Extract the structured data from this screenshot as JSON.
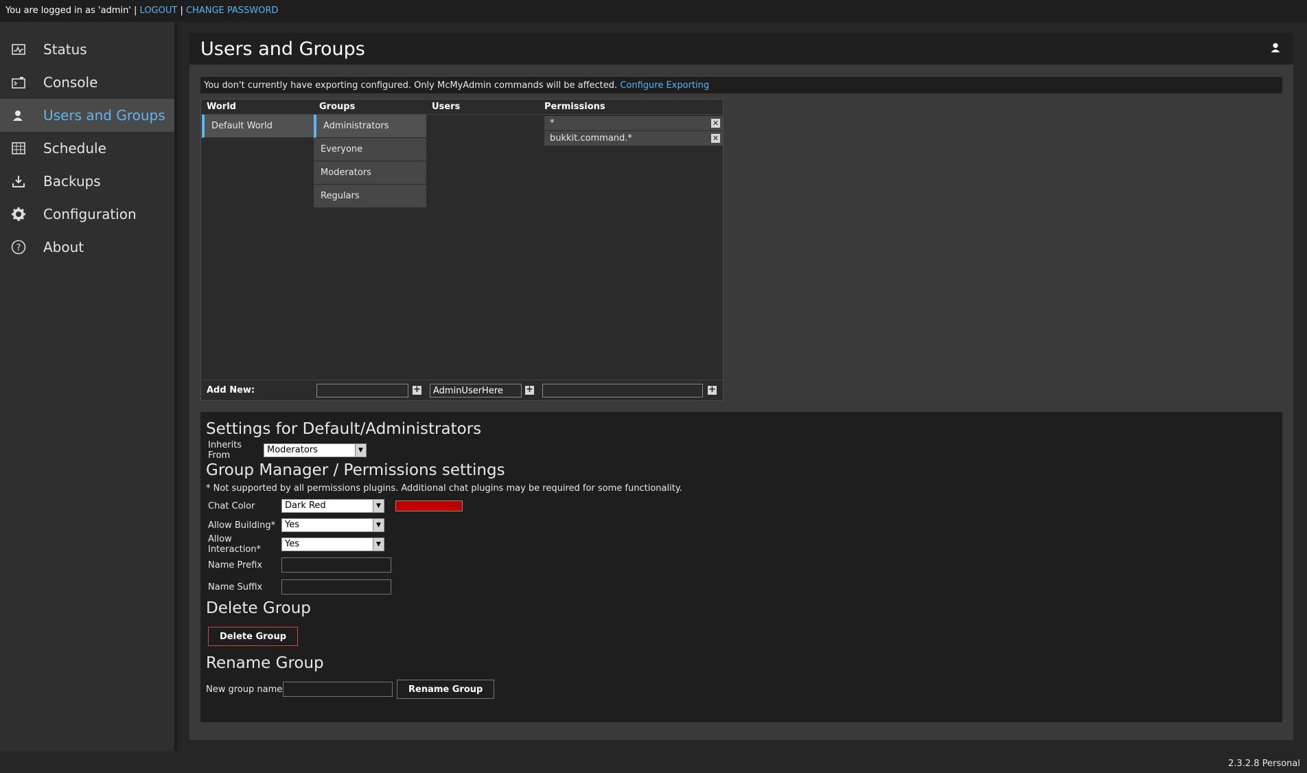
{
  "topbar": {
    "logged_in_text": "You are logged in as 'admin' |",
    "logout": "LOGOUT",
    "separator": "|",
    "change_password": "CHANGE PASSWORD"
  },
  "sidebar": {
    "items": [
      {
        "label": "Status",
        "icon": "status-icon"
      },
      {
        "label": "Console",
        "icon": "console-icon"
      },
      {
        "label": "Users and Groups",
        "icon": "users-icon",
        "active": true
      },
      {
        "label": "Schedule",
        "icon": "schedule-icon"
      },
      {
        "label": "Backups",
        "icon": "backups-icon"
      },
      {
        "label": "Configuration",
        "icon": "gear-icon"
      },
      {
        "label": "About",
        "icon": "help-icon"
      }
    ]
  },
  "page": {
    "title": "Users and Groups",
    "notice_text": "You don't currently have exporting configured. Only McMyAdmin commands will be affected.",
    "notice_link": "Configure Exporting"
  },
  "table": {
    "headers": {
      "world": "World",
      "groups": "Groups",
      "users": "Users",
      "permissions": "Permissions"
    },
    "worlds": [
      "Default World"
    ],
    "groups": [
      "Administrators",
      "Everyone",
      "Moderators",
      "Regulars"
    ],
    "permissions": [
      "*",
      "bukkit.command.*"
    ],
    "add_new_label": "Add New:",
    "add_user_value": "AdminUserHere"
  },
  "settings": {
    "title": "Settings for Default/Administrators",
    "inherits_label": "Inherits From",
    "inherits_value": "Moderators",
    "gm_title": "Group Manager / Permissions settings",
    "gm_note": "* Not supported by all permissions plugins. Additional chat plugins may be required for some functionality.",
    "chat_color_label": "Chat Color",
    "chat_color_value": "Dark Red",
    "chat_color_hex": "#c00000",
    "allow_building_label": "Allow Building*",
    "allow_building_value": "Yes",
    "allow_interaction_label": "Allow Interaction*",
    "allow_interaction_value": "Yes",
    "name_prefix_label": "Name Prefix",
    "name_suffix_label": "Name Suffix",
    "delete_title": "Delete Group",
    "delete_button": "Delete Group",
    "rename_title": "Rename Group",
    "new_name_label": "New group name",
    "rename_button": "Rename Group"
  },
  "footer": {
    "version": "2.3.2.8 Personal"
  },
  "colors": {
    "accent": "#5fb6ef",
    "danger_border": "#d04a3a"
  }
}
